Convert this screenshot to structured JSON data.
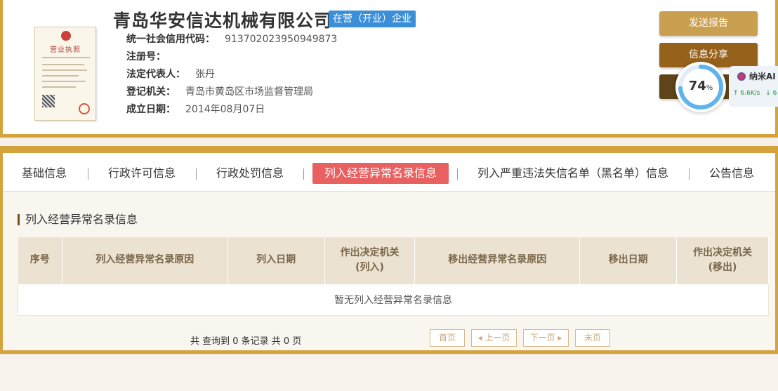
{
  "company": {
    "name": "青岛华安信达机械有限公司",
    "status_badge": "在营（开业）企业",
    "license_title": "营业执照"
  },
  "info": [
    {
      "label": "统一社会信用代码：",
      "value": "91370202395094987 3"
    },
    {
      "label": "注册号：",
      "value": ""
    },
    {
      "label": "法定代表人：",
      "value": "张丹"
    },
    {
      "label": "登记机关：",
      "value": "青岛市黄岛区市场监督管理局"
    },
    {
      "label": "成立日期：",
      "value": "2014年08月07日"
    }
  ],
  "actions": {
    "send_report": "发送报告",
    "share_info": "信息分享",
    "third": ""
  },
  "widget": {
    "percent": "74",
    "percent_unit": "%",
    "percent_value": 0.74,
    "ai_name": "纳米AI",
    "upload": "↑ 6.6K/s",
    "download": "↓ 6"
  },
  "tabs": [
    {
      "label": "基础信息",
      "active": false
    },
    {
      "label": "行政许可信息",
      "active": false
    },
    {
      "label": "行政处罚信息",
      "active": false
    },
    {
      "label": "列入经营异常名录信息",
      "active": true
    },
    {
      "label": "列入严重违法失信名单（黑名单）信息",
      "active": false
    },
    {
      "label": "公告信息",
      "active": false
    }
  ],
  "section": {
    "title": "列入经营异常名录信息",
    "columns": [
      "序号",
      "列入经营异常名录原因",
      "列入日期",
      "作出决定机关(列入)",
      "移出经营异常名录原因",
      "移出日期",
      "作出决定机关(移出)"
    ],
    "empty_text": "暂无列入经营异常名录信息"
  },
  "pager": {
    "summary": "共 查询到 0 条记录 共 0 页",
    "first": "首页",
    "prev": "◂ 上一页",
    "next": "下一页 ▸",
    "last": "末页"
  },
  "colors": {
    "gold": "#d4a33e",
    "active_tab": "#e96060",
    "badge": "#3b8fd9"
  }
}
